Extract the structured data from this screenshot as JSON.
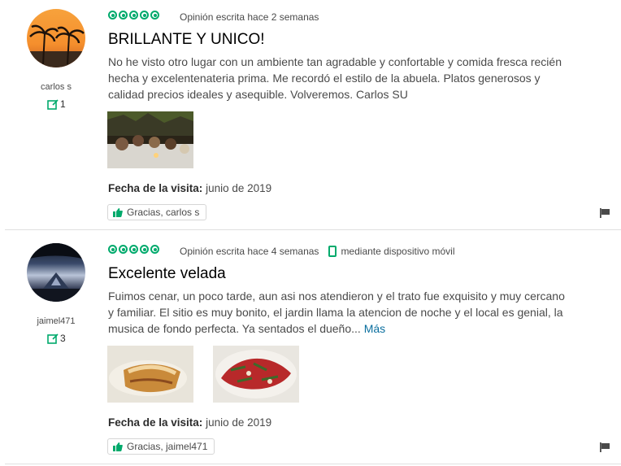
{
  "colors": {
    "accent": "#00aa6c",
    "link": "#0a6e9e"
  },
  "reviews": [
    {
      "username": "carlos s",
      "contributions": "1",
      "rating": 5,
      "written": "Opinión escrita hace 2 semanas",
      "device": "",
      "title": "BRILLANTE Y UNICO!",
      "body": "No he visto otro lugar con un ambiente tan agradable y confortable y comida fresca recién hecha y excelentenateria prima. Me recordó el estilo de la abuela. Platos generosos y calidad precios ideales y asequible. Volveremos. Carlos SU",
      "more": "",
      "visit_label": "Fecha de la visita:",
      "visit_date": "junio de 2019",
      "thanks": "Gracias, carlos s"
    },
    {
      "username": "jaimel471",
      "contributions": "3",
      "rating": 5,
      "written": "Opinión escrita hace 4 semanas",
      "device": "mediante dispositivo móvil",
      "title": "Excelente velada",
      "body": "Fuimos cenar, un poco tarde, aun asi nos atendieron y el trato fue exquisito y muy cercano y familiar. El sitio es muy bonito, el jardin llama la atencion de noche y el local es genial, la musica de fondo perfecta. Ya sentados el dueño...",
      "more": "Más",
      "visit_label": "Fecha de la visita:",
      "visit_date": "junio de 2019",
      "thanks": "Gracias, jaimel471"
    }
  ]
}
